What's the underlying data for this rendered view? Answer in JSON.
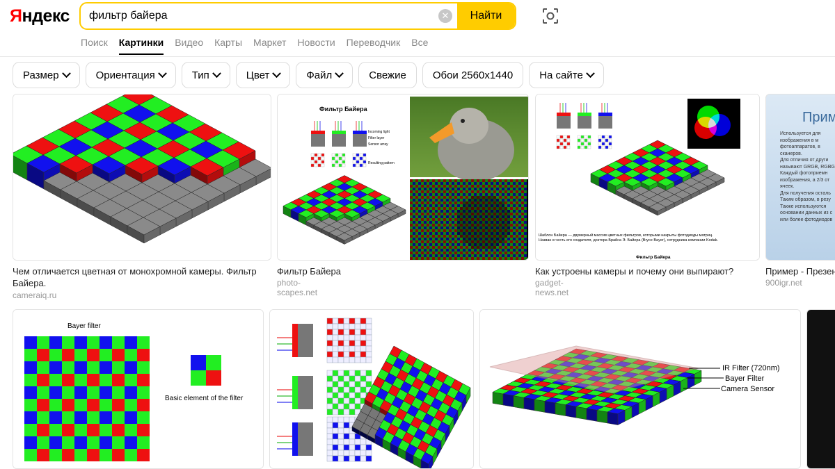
{
  "header": {
    "logo": "Яндекс",
    "search_value": "фильтр байера",
    "find_label": "Найти",
    "tabs": [
      {
        "label": "Поиск",
        "active": false
      },
      {
        "label": "Картинки",
        "active": true
      },
      {
        "label": "Видео",
        "active": false
      },
      {
        "label": "Карты",
        "active": false
      },
      {
        "label": "Маркет",
        "active": false
      },
      {
        "label": "Новости",
        "active": false
      },
      {
        "label": "Переводчик",
        "active": false
      },
      {
        "label": "Все",
        "active": false
      }
    ]
  },
  "filters": [
    {
      "label": "Размер",
      "dropdown": true
    },
    {
      "label": "Ориентация",
      "dropdown": true
    },
    {
      "label": "Тип",
      "dropdown": true
    },
    {
      "label": "Цвет",
      "dropdown": true
    },
    {
      "label": "Файл",
      "dropdown": true
    },
    {
      "label": "Свежие",
      "dropdown": false
    },
    {
      "label": "Обои 2560x1440",
      "dropdown": false
    },
    {
      "label": "На сайте",
      "dropdown": true
    }
  ],
  "results": [
    {
      "caption": "Чем отличается цветная от монохромной камеры. Фильтр Байера.",
      "source": "cameraiq.ru"
    },
    {
      "caption": "Фильтр Байера",
      "source": "photo-scapes.net",
      "image_text": {
        "title": "Фильтр Байера",
        "l1": "Incoming light",
        "l2": "Filter layer",
        "l3": "Sensor array",
        "l4": "Resulting pattern"
      }
    },
    {
      "caption": "Как устроены камеры и почему они выпирают?",
      "source": "gadget-news.net",
      "image_text": {
        "desc": "Шаблон Байера — двумерный массив цветных фильтров, которыми накрыты фотодиоды матриц.",
        "desc2": "Назван в честь его создателя, доктора Брайса Э. Байера (Bryce Bayer), сотрудника компании Kodak.",
        "footer": "Фильтр Байера"
      }
    },
    {
      "caption": "Пример - Презен",
      "source": "900igr.net",
      "image_text": {
        "title": "Прим",
        "lines": [
          "Используется для",
          "изображения в м",
          "фотоаппаратов, в",
          "сканеров.",
          "Для отличия от други",
          "называют GRGB, RGBG,",
          "Каждый фотоприемн",
          "изображения, а 2/3 от",
          "ячеек.",
          "Для получения осталь",
          "Таким образом, в резу",
          "Также используются",
          "основании данных из с",
          "или более фотодиодов"
        ]
      }
    },
    {
      "image_text": {
        "title": "Bayer filter",
        "label": "Basic element of the filter"
      }
    },
    {},
    {
      "image_text": {
        "l1": "IR Filter (720nm)",
        "l2": "Bayer Filter",
        "l3": "Camera Sensor"
      }
    },
    {}
  ],
  "colors": {
    "accent": "#ffcc00",
    "logo_red": "#ff0000",
    "bayer_red": "#ee1111",
    "bayer_green": "#22ee22",
    "bayer_blue": "#1111ee"
  }
}
